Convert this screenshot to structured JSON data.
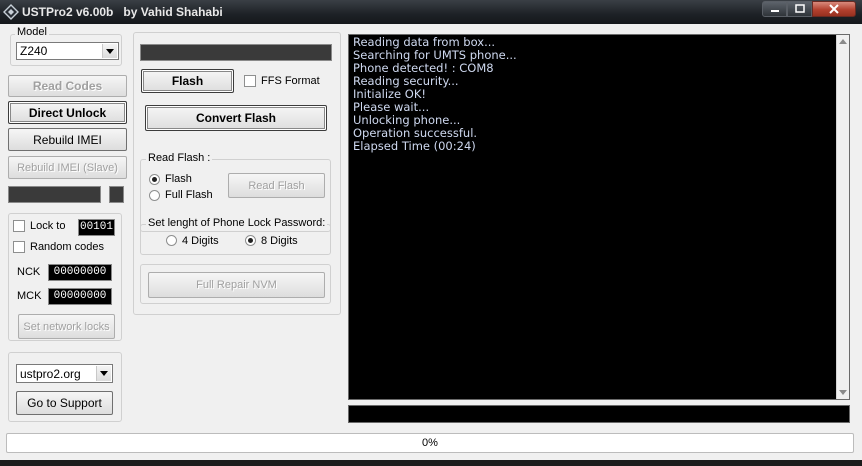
{
  "window": {
    "title": "USTPro2 v6.00b   by Vahid Shahabi",
    "minimize": "minimize",
    "maximize": "maximize",
    "close": "close"
  },
  "left": {
    "model_label": "Model",
    "model_value": "Z240",
    "read_codes": "Read Codes",
    "direct_unlock": "Direct Unlock",
    "rebuild_imei": "Rebuild IMEI",
    "rebuild_imei_slave": "Rebuild IMEI (Slave)",
    "lock_to_label": "Lock to",
    "lock_to_value": "00101",
    "random_codes": "Random codes",
    "nck_label": "NCK",
    "nck_value": "00000000",
    "mck_label": "MCK",
    "mck_value": "00000000",
    "set_network_locks": "Set network locks",
    "support_site": "ustpro2.org",
    "go_to_support": "Go to Support"
  },
  "middle": {
    "flash": "Flash",
    "ffs_format": "FFS Format",
    "convert_flash": "Convert Flash",
    "read_flash_group": "Read Flash :",
    "radio_flash": "Flash",
    "radio_full_flash": "Full Flash",
    "read_flash_btn": "Read Flash",
    "lock_password_group": "Set lenght of Phone Lock Password:",
    "digits4": "4 Digits",
    "digits8": "8 Digits",
    "full_repair_nvm": "Full Repair NVM"
  },
  "console": {
    "lines": [
      "Reading data from box...",
      "Searching for UMTS phone...",
      "Phone detected! : COM8",
      "Reading security...",
      "Initialize OK!",
      "Please wait...",
      "Unlocking phone...",
      "Operation successful.",
      "Elapsed Time (00:24)"
    ]
  },
  "progress": {
    "value": 0,
    "label": "0%"
  },
  "colors": {
    "console_text": "#cfd9f0",
    "progress_fill": "#3cb24a"
  }
}
